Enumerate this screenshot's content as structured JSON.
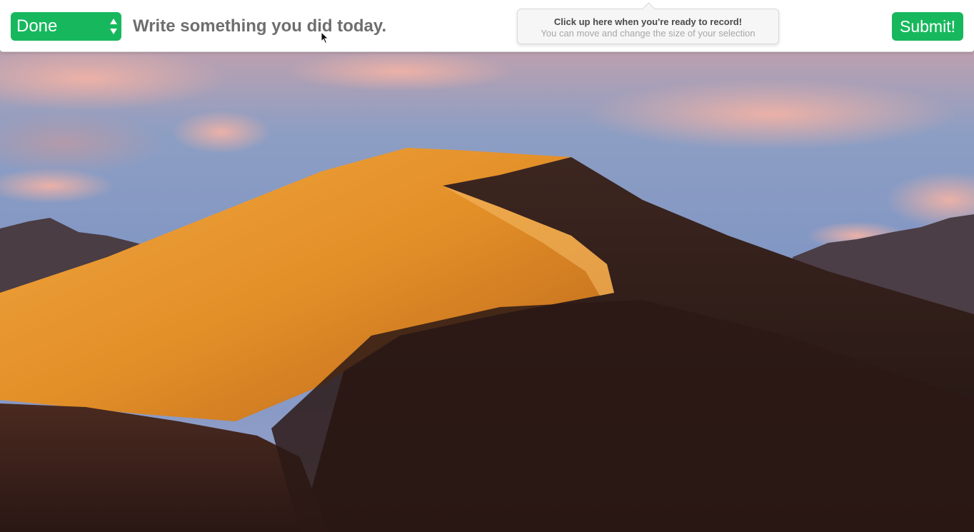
{
  "toolbar": {
    "status_value": "Done",
    "task_placeholder": "Write something you did today.",
    "submit_label": "Submit!"
  },
  "record_tip": {
    "title": "Click up here when you're ready to record!",
    "subtitle": "You can move and change the size of your selection"
  },
  "colors": {
    "accent_green": "#17b85d",
    "placeholder_gray": "#6e6e6e"
  },
  "icons": {
    "status_arrows": "select-arrows-icon",
    "cursor": "mouse-pointer-icon"
  }
}
